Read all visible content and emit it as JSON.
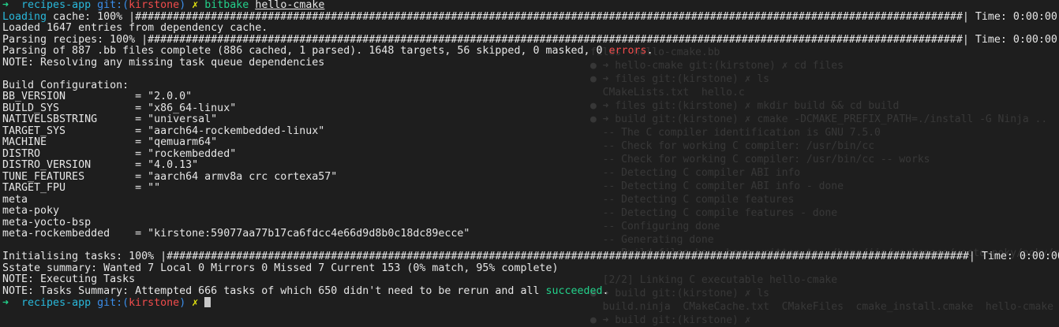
{
  "prompt": {
    "arrow": "➜",
    "dir": "recipes-app",
    "git_open": "git:(",
    "branch": "kirstone",
    "git_close": ")",
    "dirty": "✗",
    "command": "bitbake",
    "arg": "hello-cmake"
  },
  "output": {
    "loading_label": "Loading",
    "loading_rest": " cache: 100% |###################################################################################################################################| Time: 0:00:00",
    "loaded": "Loaded 1647 entries from dependency cache.",
    "parsing": "Parsing recipes: 100% |#################################################################################################################################| Time: 0:00:00",
    "parse_complete": "Parsing of 887 .bb files complete (886 cached, 1 parsed). 1648 targets, 56 skipped, 0 masked, 0 ",
    "errors_word": "errors",
    "period": ".",
    "note_resolving": "NOTE: Resolving any missing task queue dependencies",
    "build_config_title": "Build Configuration:",
    "config": [
      "BB_VERSION           = \"2.0.0\"",
      "BUILD_SYS            = \"x86_64-linux\"",
      "NATIVELSBSTRING      = \"universal\"",
      "TARGET_SYS           = \"aarch64-rockembedded-linux\"",
      "MACHINE              = \"qemuarm64\"",
      "DISTRO               = \"rockembedded\"",
      "DISTRO_VERSION       = \"4.0.13\"",
      "TUNE_FEATURES        = \"aarch64 armv8a crc cortexa57\"",
      "TARGET_FPU           = \"\"",
      "meta                 ",
      "meta-poky            ",
      "meta-yocto-bsp       ",
      "meta-rockembedded    = \"kirstone:59077aa77b17ca6fdcc4e66d9d8b0c18dc89ecce\""
    ],
    "init_tasks": "Initialising tasks: 100% |###############################################################################################################################| Time: 0:00:00",
    "sstate": "Sstate summary: Wanted 7 Local 0 Mirrors 0 Missed 7 Current 153 (0% match, 95% complete)",
    "executing": "NOTE: Executing Tasks",
    "summary": "NOTE: Tasks Summary: Attempted 666 tasks of which 650 didn't need to be rerun and all ",
    "succeeded": "succeeded"
  },
  "background_terminal": [
    "files  hello-cmake.bb",
    "● ➜ hello-cmake git:(kirstone) ✗ cd files",
    "● ➜ files git:(kirstone) ✗ ls",
    "  CMakeLists.txt  hello.c",
    "● ➜ files git:(kirstone) ✗ mkdir build && cd build",
    "● ➜ build git:(kirstone) ✗ cmake -DCMAKE_PREFIX_PATH=./install -G Ninja ..",
    "  -- The C compiler identification is GNU 7.5.0",
    "  -- Check for working C compiler: /usr/bin/cc",
    "  -- Check for working C compiler: /usr/bin/cc -- works",
    "  -- Detecting C compiler ABI info",
    "  -- Detecting C compiler ABI info - done",
    "  -- Detecting C compile features",
    "  -- Detecting C compile features - done",
    "  -- Configuring done",
    "  -- Generating done",
    "  -- Build files have been written to: /home/jie/workspace/yocto-poky/poky/meta-rocke",
    "",
    "  [2/2] Linking C executable hello-cmake",
    "● ➜ build git:(kirstone) ✗ ls",
    "  build.ninja  CMakeCache.txt  CMakeFiles  cmake_install.cmake  hello-cmake  rules.ni",
    "● ➜ build git:(kirstone) ✗"
  ],
  "colors": {
    "background": "#1e1e1e",
    "green": "#23d18b",
    "cyan": "#29b8db",
    "red": "#f14c4c",
    "yellow": "#e5e510"
  }
}
